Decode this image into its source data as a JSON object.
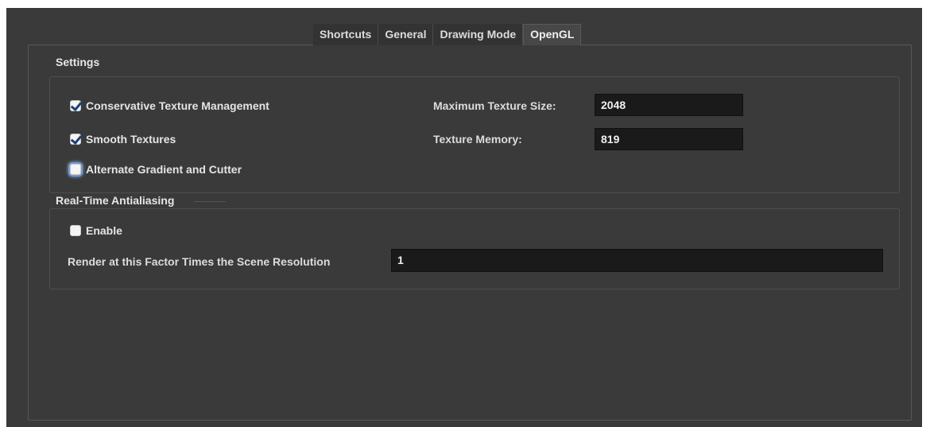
{
  "tabs": [
    {
      "label": "Shortcuts",
      "active": false
    },
    {
      "label": "General",
      "active": false
    },
    {
      "label": "Drawing Mode",
      "active": false
    },
    {
      "label": "OpenGL",
      "active": true
    }
  ],
  "settings": {
    "title": "Settings",
    "conservative_texture": {
      "label": "Conservative Texture Management",
      "checked": true
    },
    "smooth_textures": {
      "label": "Smooth Textures",
      "checked": true
    },
    "alternate_gradient": {
      "label": "Alternate Gradient and Cutter",
      "checked": false
    },
    "max_texture_size": {
      "label": "Maximum Texture Size:",
      "value": "2048"
    },
    "texture_memory": {
      "label": "Texture Memory:",
      "value": "819"
    }
  },
  "antialiasing": {
    "title": "Real-Time Antialiasing",
    "enable": {
      "label": "Enable",
      "checked": false
    },
    "render_factor": {
      "label": "Render at this Factor Times the Scene Resolution",
      "value": "1"
    }
  },
  "colors": {
    "background": "#3a3a3a",
    "field": "#1a1a1a",
    "check_mark": "#1b3f7a",
    "focus": "#6d9ad6"
  }
}
